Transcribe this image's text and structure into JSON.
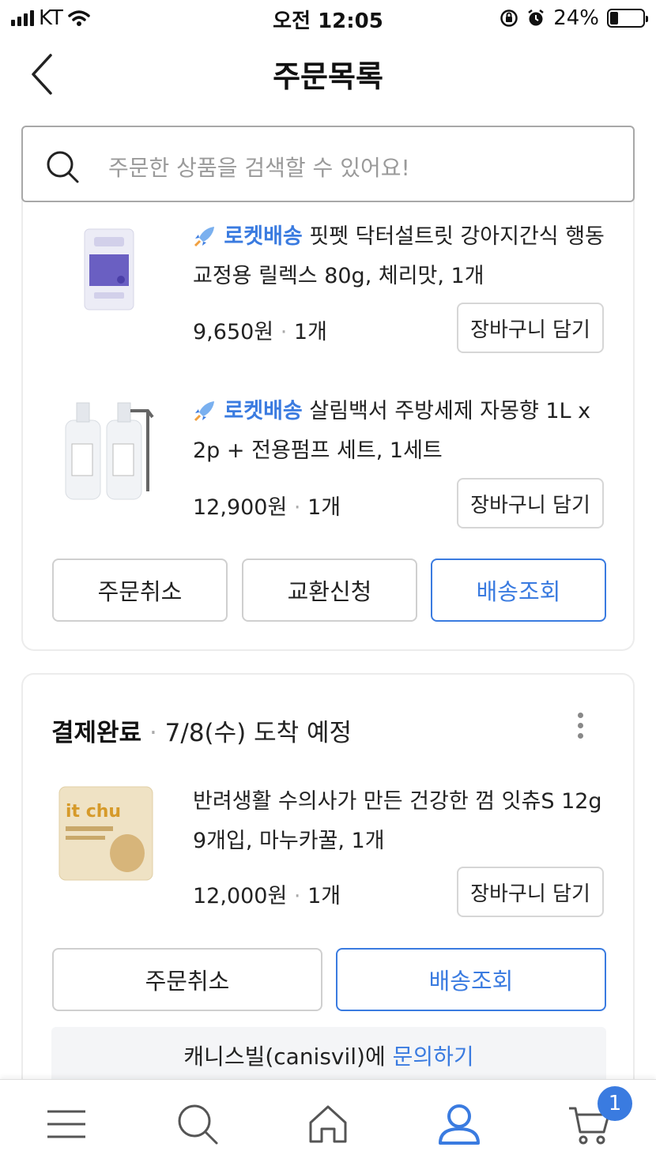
{
  "status_bar": {
    "carrier": "KT",
    "time": "오전 12:05",
    "battery": "24%",
    "battery_level": 0.24
  },
  "header": {
    "title": "주문목록"
  },
  "search": {
    "placeholder": "주문한 상품을 검색할 수 있어요!"
  },
  "order1": {
    "items": [
      {
        "badge": "로켓배송",
        "name": "핏펫 닥터설트릿 강아지간식 행동교정용 릴렉스 80g, 체리맛, 1개",
        "price": "9,650원",
        "qty": "1개",
        "cart_label": "장바구니 담기"
      },
      {
        "badge": "로켓배송",
        "name": "살림백서 주방세제 자몽향 1L x 2p + 전용펌프 세트, 1세트",
        "price": "12,900원",
        "qty": "1개",
        "cart_label": "장바구니 담기"
      }
    ],
    "actions": {
      "cancel": "주문취소",
      "exchange": "교환신청",
      "track": "배송조회"
    }
  },
  "order2": {
    "status": "결제완료",
    "eta": "7/8(수) 도착 예정",
    "items": [
      {
        "brand_text": "it chu",
        "name": "반려생활 수의사가 만든 건강한 껌 잇츄S 12g 9개입, 마누카꿀, 1개",
        "price": "12,000원",
        "qty": "1개",
        "cart_label": "장바구니 담기"
      }
    ],
    "actions": {
      "cancel": "주문취소",
      "track": "배송조회"
    },
    "inquiry": {
      "seller": "캐니스빌(canisvil)에",
      "link": "문의하기"
    }
  },
  "tab_bar": {
    "cart_badge": "1",
    "active_tab": "my",
    "active_color": "#3a7be0"
  }
}
